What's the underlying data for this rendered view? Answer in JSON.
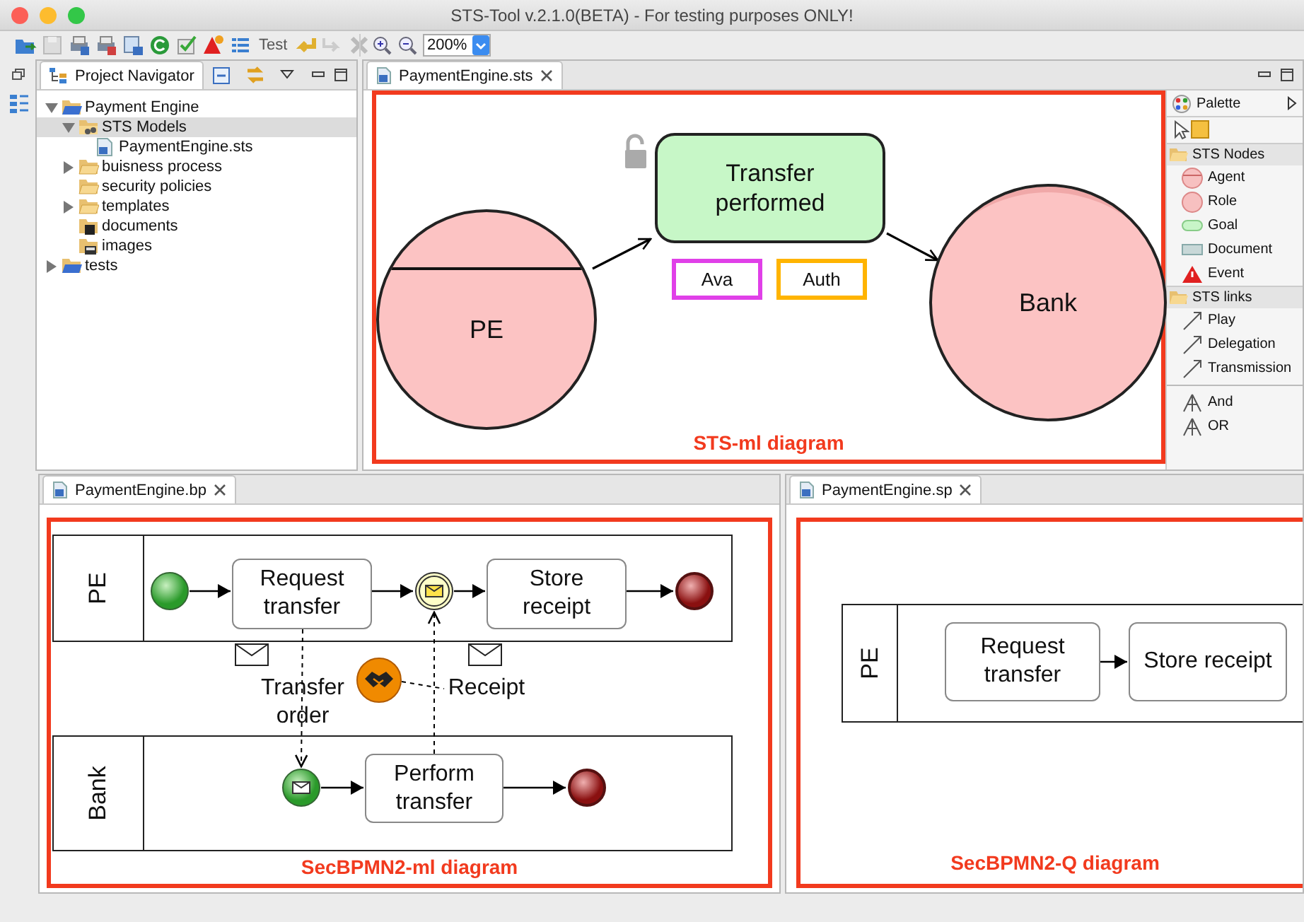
{
  "window": {
    "title": "STS-Tool v.2.1.0(BETA) - For testing purposes ONLY!"
  },
  "toolbar": {
    "test_button": "Test",
    "zoom": "200%"
  },
  "navigator": {
    "title": "Project Navigator",
    "tree": [
      {
        "label": "Payment Engine",
        "kind": "project",
        "expanded": true,
        "selected": false,
        "children": [
          {
            "label": "STS Models",
            "kind": "model-folder",
            "expanded": true,
            "selected": true,
            "children": [
              {
                "label": "PaymentEngine.sts",
                "kind": "file",
                "selected": false
              }
            ]
          },
          {
            "label": "buisness process",
            "kind": "folder",
            "expanded": false,
            "selected": false
          },
          {
            "label": "security policies",
            "kind": "folder",
            "selected": false
          },
          {
            "label": "templates",
            "kind": "folder",
            "expanded": false,
            "selected": false
          },
          {
            "label": "documents",
            "kind": "doc-folder",
            "selected": false
          },
          {
            "label": "images",
            "kind": "image-folder",
            "selected": false
          }
        ]
      },
      {
        "label": "tests",
        "kind": "project",
        "expanded": false,
        "selected": false
      }
    ]
  },
  "sts_editor": {
    "tab": "PaymentEngine.sts",
    "nodes": [
      {
        "kind": "agent",
        "label": "PE"
      },
      {
        "kind": "goal",
        "label": "Transfer performed"
      },
      {
        "kind": "need",
        "label": "Ava",
        "color": "#e040e8"
      },
      {
        "kind": "need",
        "label": "Auth",
        "color": "#ffb400"
      },
      {
        "kind": "role",
        "label": "Bank"
      }
    ],
    "caption": "STS-ml diagram"
  },
  "palette": {
    "title": "Palette",
    "sections": [
      {
        "title": "STS Nodes",
        "items": [
          {
            "kind": "agent",
            "label": "Agent"
          },
          {
            "kind": "role",
            "label": "Role"
          },
          {
            "kind": "goal",
            "label": "Goal"
          },
          {
            "kind": "document",
            "label": "Document"
          },
          {
            "kind": "event",
            "label": "Event"
          }
        ]
      },
      {
        "title": "STS links",
        "items": [
          {
            "kind": "link",
            "label": "Play"
          },
          {
            "kind": "link",
            "label": "Delegation"
          },
          {
            "kind": "link",
            "label": "Transmission"
          }
        ]
      },
      {
        "items": [
          {
            "kind": "and",
            "label": "And"
          },
          {
            "kind": "and",
            "label": "OR"
          }
        ]
      }
    ]
  },
  "bp_editor": {
    "tab": "PaymentEngine.bp",
    "lanes": [
      {
        "label": "PE"
      },
      {
        "label": "Bank"
      }
    ],
    "nodes": [
      {
        "kind": "start"
      },
      {
        "kind": "task",
        "label": "Request transfer"
      },
      {
        "kind": "message-catch"
      },
      {
        "kind": "task",
        "label": "Store receipt"
      },
      {
        "kind": "end"
      },
      {
        "kind": "message-start"
      },
      {
        "kind": "task",
        "label": "Perform transfer"
      },
      {
        "kind": "end"
      }
    ],
    "messages": [
      {
        "label": "Transfer order"
      },
      {
        "label": "Receipt"
      }
    ],
    "caption": "SecBPMN2-ml diagram"
  },
  "sp_editor": {
    "tab": "PaymentEngine.sp",
    "lanes": [
      {
        "label": "PE"
      }
    ],
    "nodes": [
      {
        "kind": "task",
        "label": "Request transfer"
      },
      {
        "kind": "task",
        "label": "Store receipt"
      }
    ],
    "caption": "SecBPMN2-Q diagram"
  }
}
